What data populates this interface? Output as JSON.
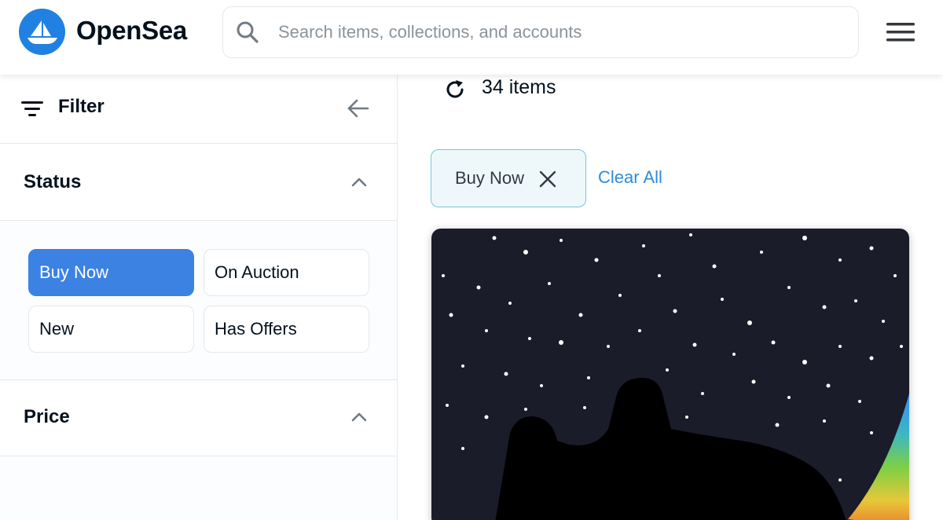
{
  "header": {
    "brand": "OpenSea",
    "logo_icon": "opensea-boat-logo",
    "search_placeholder": "Search items, collections, and accounts",
    "menu_icon": "hamburger-menu-icon",
    "brand_color": "#2081e2"
  },
  "sidebar": {
    "filter_label": "Filter",
    "status": {
      "label": "Status",
      "options": [
        {
          "label": "Buy Now",
          "selected": true
        },
        {
          "label": "On Auction",
          "selected": false
        },
        {
          "label": "New",
          "selected": false
        },
        {
          "label": "Has Offers",
          "selected": false
        }
      ]
    },
    "price": {
      "label": "Price"
    }
  },
  "main": {
    "items_count": "34 items",
    "active_filters": [
      {
        "label": "Buy Now"
      }
    ],
    "clear_all": "Clear All"
  },
  "colors": {
    "selected_chip": "#3b82e3",
    "active_filter_border": "#7cc5d6",
    "active_filter_bg": "#eef8fa",
    "link": "#2e8bd8"
  }
}
